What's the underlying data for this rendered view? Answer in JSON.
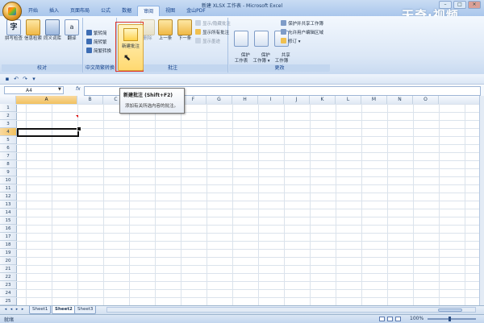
{
  "window": {
    "title": "新建 XLSX 工作表 - Microsoft Excel",
    "watermark": "天奇·视频"
  },
  "tabs": [
    "开始",
    "插入",
    "页面布局",
    "公式",
    "数据",
    "审阅",
    "视图",
    "金山PDF"
  ],
  "active_tab": "审阅",
  "ribbon": {
    "proofing": {
      "label": "校对",
      "buttons": [
        "拼写检查",
        "信息检索",
        "同义词库",
        "翻译"
      ]
    },
    "chinese": {
      "label": "中文简繁转换",
      "buttons": [
        "繁转简",
        "简转繁",
        "简繁转换"
      ]
    },
    "comments": {
      "label": "批注",
      "buttons": [
        "新建批注",
        "删除",
        "上一条",
        "下一条"
      ],
      "small": [
        "显示/隐藏批注",
        "显示所有批注",
        "显示墨迹"
      ]
    },
    "changes": {
      "label": "更改",
      "buttons": [
        "保护\n工作表",
        "保护\n工作簿 ▾",
        "共享\n工作簿"
      ],
      "small": [
        "保护并共享工作簿",
        "允许用户编辑区域",
        "修订 ▾"
      ]
    }
  },
  "namebox": "A4",
  "fx": "fx",
  "tooltip": {
    "title": "新建批注 (Shift+F2)",
    "desc": "添加有关所选内容的批注。"
  },
  "columns": [
    "A",
    "B",
    "C",
    "D",
    "E",
    "F",
    "G",
    "H",
    "I",
    "J",
    "K",
    "L",
    "M",
    "N",
    "O"
  ],
  "selected_column": "A",
  "rows": [
    "1",
    "2",
    "3",
    "4",
    "5",
    "6",
    "7",
    "8",
    "9",
    "10",
    "11",
    "12",
    "13",
    "14",
    "15",
    "16",
    "17",
    "18",
    "19",
    "20",
    "21",
    "22",
    "23",
    "24",
    "25"
  ],
  "selected_row": "4",
  "sheets": [
    "Sheet1",
    "Sheet2",
    "Sheet3"
  ],
  "active_sheet": "Sheet2",
  "status": "就绪",
  "zoom": "100%"
}
